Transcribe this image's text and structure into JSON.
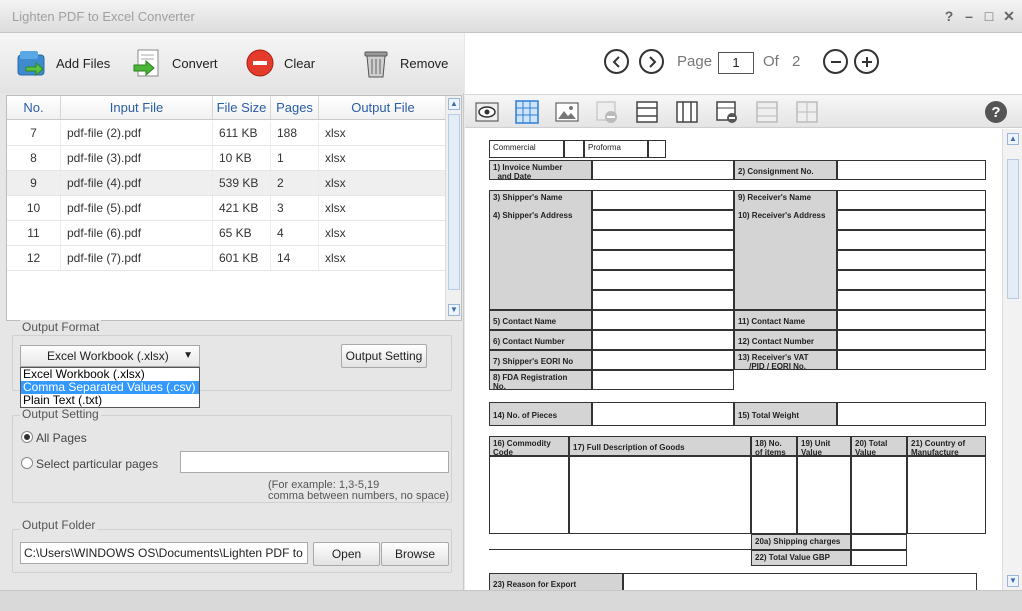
{
  "window": {
    "title": "Lighten PDF to Excel Converter",
    "help": "?",
    "minimize": "–",
    "maximize": "□",
    "close": "✕"
  },
  "toolbar": {
    "add_files": "Add Files",
    "convert": "Convert",
    "clear": "Clear",
    "remove": "Remove"
  },
  "file_table": {
    "headers": {
      "no": "No.",
      "input": "Input File",
      "size": "File Size",
      "pages": "Pages",
      "output": "Output File"
    },
    "rows": [
      {
        "no": "7",
        "input": "pdf-file (2).pdf",
        "size": "611 KB",
        "pages": "188",
        "output": "xlsx"
      },
      {
        "no": "8",
        "input": "pdf-file (3).pdf",
        "size": "10 KB",
        "pages": "1",
        "output": "xlsx"
      },
      {
        "no": "9",
        "input": "pdf-file (4).pdf",
        "size": "539 KB",
        "pages": "2",
        "output": "xlsx"
      },
      {
        "no": "10",
        "input": "pdf-file (5).pdf",
        "size": "421 KB",
        "pages": "3",
        "output": "xlsx"
      },
      {
        "no": "11",
        "input": "pdf-file (6).pdf",
        "size": "65 KB",
        "pages": "4",
        "output": "xlsx"
      },
      {
        "no": "12",
        "input": "pdf-file (7).pdf",
        "size": "601 KB",
        "pages": "14",
        "output": "xlsx"
      }
    ]
  },
  "output_format": {
    "title": "Output Format",
    "selected": "Excel Workbook (.xlsx)",
    "options": [
      "Excel Workbook (.xlsx)",
      "Comma Separated Values (.csv)",
      "Plain Text (.txt)"
    ],
    "setting_button": "Output Setting"
  },
  "output_setting": {
    "title": "Output Setting",
    "all_pages": "All Pages",
    "particular_pages": "Select particular pages",
    "pages_value": "",
    "hint_line1": "(For example: 1,3-5,19",
    "hint_line2": "comma between numbers, no space)"
  },
  "output_folder": {
    "title": "Output Folder",
    "path": "C:\\Users\\WINDOWS OS\\Documents\\Lighten PDF to Excel C",
    "open": "Open",
    "browse": "Browse"
  },
  "preview_nav": {
    "page_label": "Page",
    "page_value": "1",
    "of_label": "Of",
    "total": "2",
    "help": "?"
  },
  "document": {
    "commercial": "Commercial",
    "proforma": "Proforma",
    "f1": "1) Invoice Number",
    "f1b": "and Date",
    "f2": "2) Consignment No.",
    "f3": "3) Shipper's Name",
    "f4": "4) Shipper's Address",
    "f5": "5) Contact Name",
    "f6": "6) Contact Number",
    "f7": "7) Shipper's EORI No",
    "f8": "8) FDA Registration",
    "f8b": "No.",
    "f9": "9) Receiver's Name",
    "f10": "10) Receiver's Address",
    "f11": "11) Contact Name",
    "f12": "12) Contact Number",
    "f13": "13) Receiver's VAT",
    "f13b": "/PID / EORI No.",
    "f14": "14) No. of Pieces",
    "f15": "15) Total Weight",
    "f16": "16) Commodity",
    "f16b": "Code",
    "f17": "17) Full Description of Goods",
    "f18": "18) No.",
    "f18b": "of items",
    "f19": "19) Unit",
    "f19b": "Value",
    "f20": "20) Total",
    "f20b": "Value",
    "f21": "21) Country of",
    "f21b": "Manufacture",
    "f20a": "20a) Shipping charges",
    "f22": "22) Total Value GBP",
    "f23": "23) Reason for Export"
  }
}
